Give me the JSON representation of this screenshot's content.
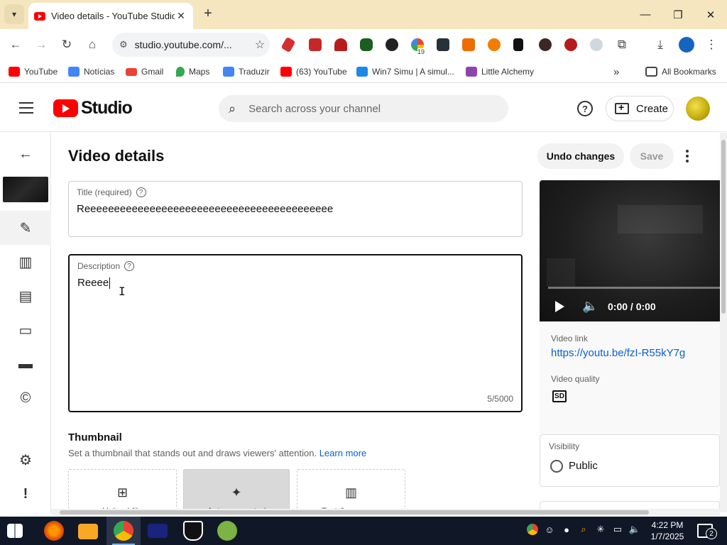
{
  "browser": {
    "tab_title": "Video details - YouTube Studio",
    "url": "studio.youtube.com/...",
    "bookmarks": [
      {
        "label": "YouTube",
        "color": "#ff0000"
      },
      {
        "label": "Notícias",
        "color": "#4285f4"
      },
      {
        "label": "Gmail",
        "color": "#ea4335"
      },
      {
        "label": "Maps",
        "color": "#34a853"
      },
      {
        "label": "Traduzir",
        "color": "#4285f4"
      },
      {
        "label": "(63) YouTube",
        "color": "#ff0000"
      },
      {
        "label": "Win7 Simu | A simul...",
        "color": "#1e88e5"
      },
      {
        "label": "Little Alchemy",
        "color": "#8e44ad"
      }
    ],
    "all_bookmarks": "All Bookmarks",
    "extension_badge": "19"
  },
  "header": {
    "logo_text": "Studio",
    "search_placeholder": "Search across your channel",
    "create_label": "Create"
  },
  "page": {
    "title": "Video details",
    "undo_label": "Undo changes",
    "save_label": "Save"
  },
  "title_field": {
    "label": "Title (required)",
    "value": "Reeeeeeeeeeeeeeeeeeeeeeeeeeeeeeeeeeeeeeeeee"
  },
  "description_field": {
    "label": "Description",
    "value": "Reeee",
    "counter": "5/5000"
  },
  "thumbnail": {
    "title": "Thumbnail",
    "subtitle": "Set a thumbnail that stands out and draws viewers' attention.",
    "learn_more": "Learn more",
    "options": [
      "Upload file",
      "Auto-generated",
      "Test & compare"
    ]
  },
  "video": {
    "time": "0:00 / 0:00",
    "link_label": "Video link",
    "link": "https://youtu.be/fzI-R55kY7g",
    "quality_label": "Video quality",
    "quality": "SD"
  },
  "visibility": {
    "label": "Visibility",
    "value": "Public"
  },
  "taskbar": {
    "time": "4:22 PM",
    "date": "1/7/2025",
    "notifications": "2"
  }
}
